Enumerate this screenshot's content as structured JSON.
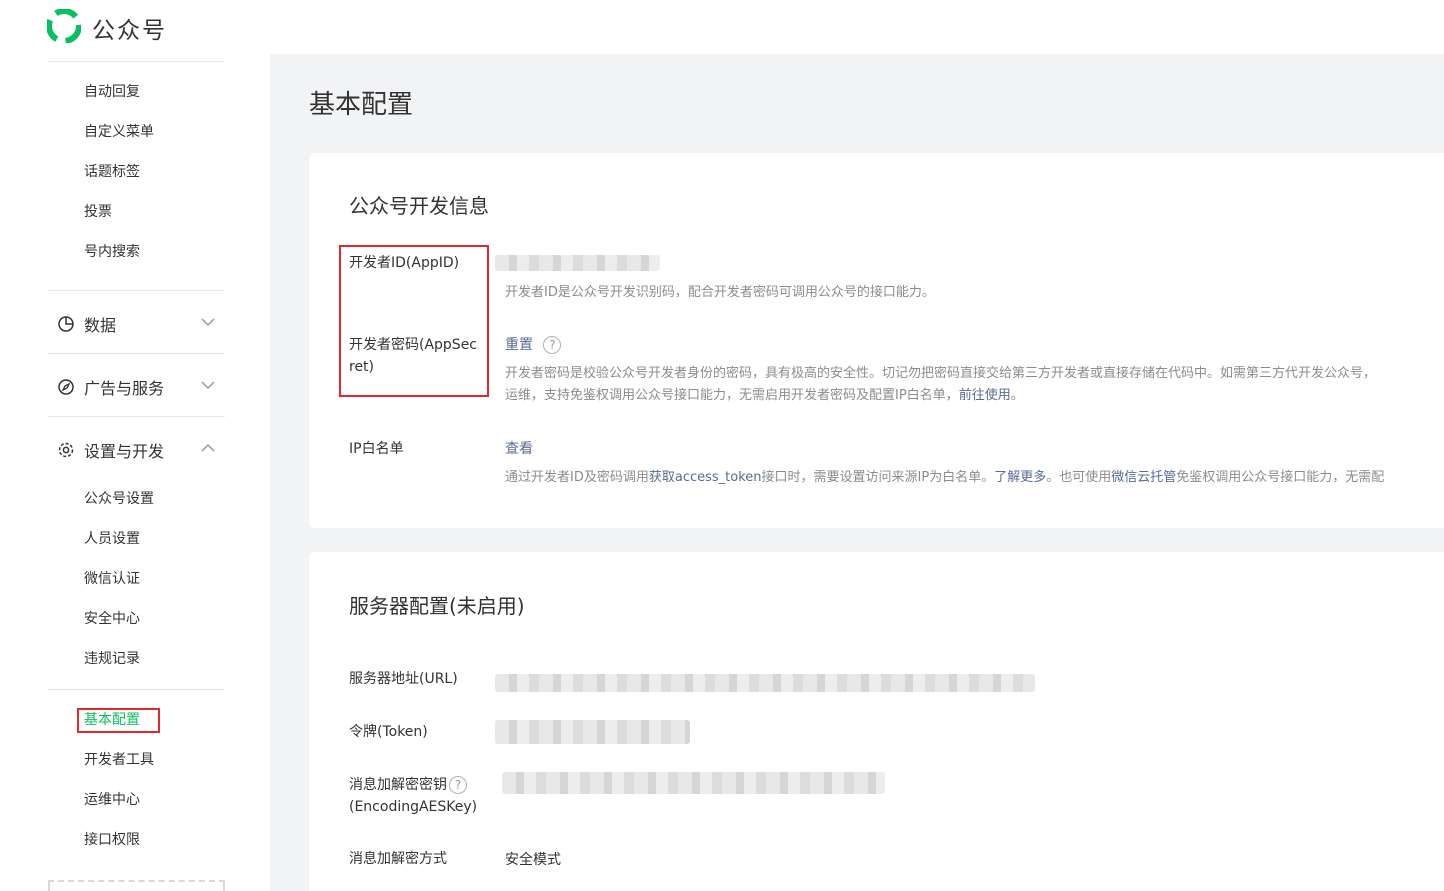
{
  "header": {
    "brand": "公众号",
    "logo_icon": "wechat-mp-logo-icon",
    "accent": "#07c160"
  },
  "sidebar": {
    "top_items": [
      "自动回复",
      "自定义菜单",
      "话题标签",
      "投票",
      "号内搜索"
    ],
    "groups": {
      "data": {
        "label": "数据",
        "icon": "pie-chart-icon"
      },
      "ads": {
        "label": "广告与服务",
        "icon": "compass-icon"
      },
      "settings": {
        "label": "设置与开发",
        "icon": "gear-icon"
      }
    },
    "settings_items": [
      "公众号设置",
      "人员设置",
      "微信认证",
      "安全中心",
      "违规记录"
    ],
    "dev_items": [
      "基本配置",
      "开发者工具",
      "运维中心",
      "接口权限"
    ]
  },
  "main": {
    "title": "基本配置",
    "dev_info": {
      "title": "公众号开发信息",
      "appid_label": "开发者ID(AppID)",
      "appid_desc": "开发者ID是公众号开发识别码，配合开发者密码可调用公众号的接口能力。",
      "secret_label_1": "开发者密码(AppSec",
      "secret_label_2": "ret)",
      "secret_reset": "重置",
      "secret_desc_1": "开发者密码是校验公众号开发者身份的密码，具有极高的安全性。切记勿把密码直接交给第三方开发者或直接存储在代码中。如需第三方代开发公众号，",
      "secret_desc_2a": "运维，支持免鉴权调用公众号接口能力，无需启用开发者密码及配置IP白名单，",
      "secret_desc_2_link": "前往使用",
      "secret_desc_2b": "。",
      "ip_label": "IP白名单",
      "ip_view": "查看",
      "ip_desc_a": "通过开发者ID及密码调用",
      "ip_desc_link1": "获取access_token",
      "ip_desc_b": "接口时，需要设置访问来源IP为白名单。",
      "ip_desc_link2": "了解更多",
      "ip_desc_c": "。也可使用",
      "ip_desc_link3": "微信云托管",
      "ip_desc_d": "免鉴权调用公众号接口能力，无需配"
    },
    "server": {
      "title": "服务器配置(未启用)",
      "url_label": "服务器地址(URL)",
      "token_label": "令牌(Token)",
      "aes_label_1": "消息加解密密钥",
      "aes_label_2": "(EncodingAESKey)",
      "mode_label": "消息加解密方式",
      "mode_value": "安全模式"
    }
  }
}
